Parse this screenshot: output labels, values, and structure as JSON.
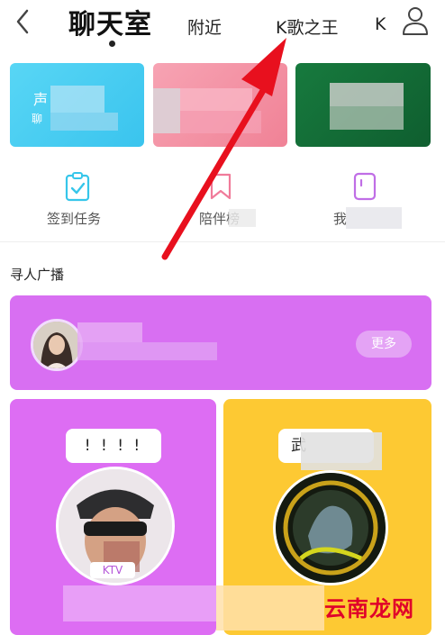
{
  "nav": {
    "back_icon": "chevron-left-icon",
    "tabs": [
      {
        "label": "聊天室",
        "active": true
      },
      {
        "label": "附近",
        "active": false
      },
      {
        "label": "K歌之王",
        "active": false
      },
      {
        "label": "K",
        "active": false
      }
    ],
    "profile_icon": "user-icon"
  },
  "banners": [
    {
      "title": "声",
      "subtitle": "聊"
    },
    {
      "title": "",
      "subtitle": ""
    },
    {
      "title": "",
      "subtitle": ""
    }
  ],
  "quick_actions": [
    {
      "label": "签到任务",
      "icon": "checkin-clipboard-icon",
      "color": "#36c6ea"
    },
    {
      "label": "陪伴榜",
      "icon": "bookmark-icon",
      "color": "#f07b9a"
    },
    {
      "label": "我",
      "icon": "phone-card-icon",
      "color": "#c06ee6"
    }
  ],
  "section": {
    "title": "寻人广播"
  },
  "broadcast": {
    "more_label": "更多"
  },
  "rooms": [
    {
      "bubble_text": "! ! ! !",
      "tag": "KTV"
    },
    {
      "bubble_text": "武"
    }
  ],
  "watermark": "云南龙网",
  "colors": {
    "accent_purple": "#d86ff2",
    "accent_yellow": "#fdc933",
    "arrow_red": "#e8101e"
  }
}
